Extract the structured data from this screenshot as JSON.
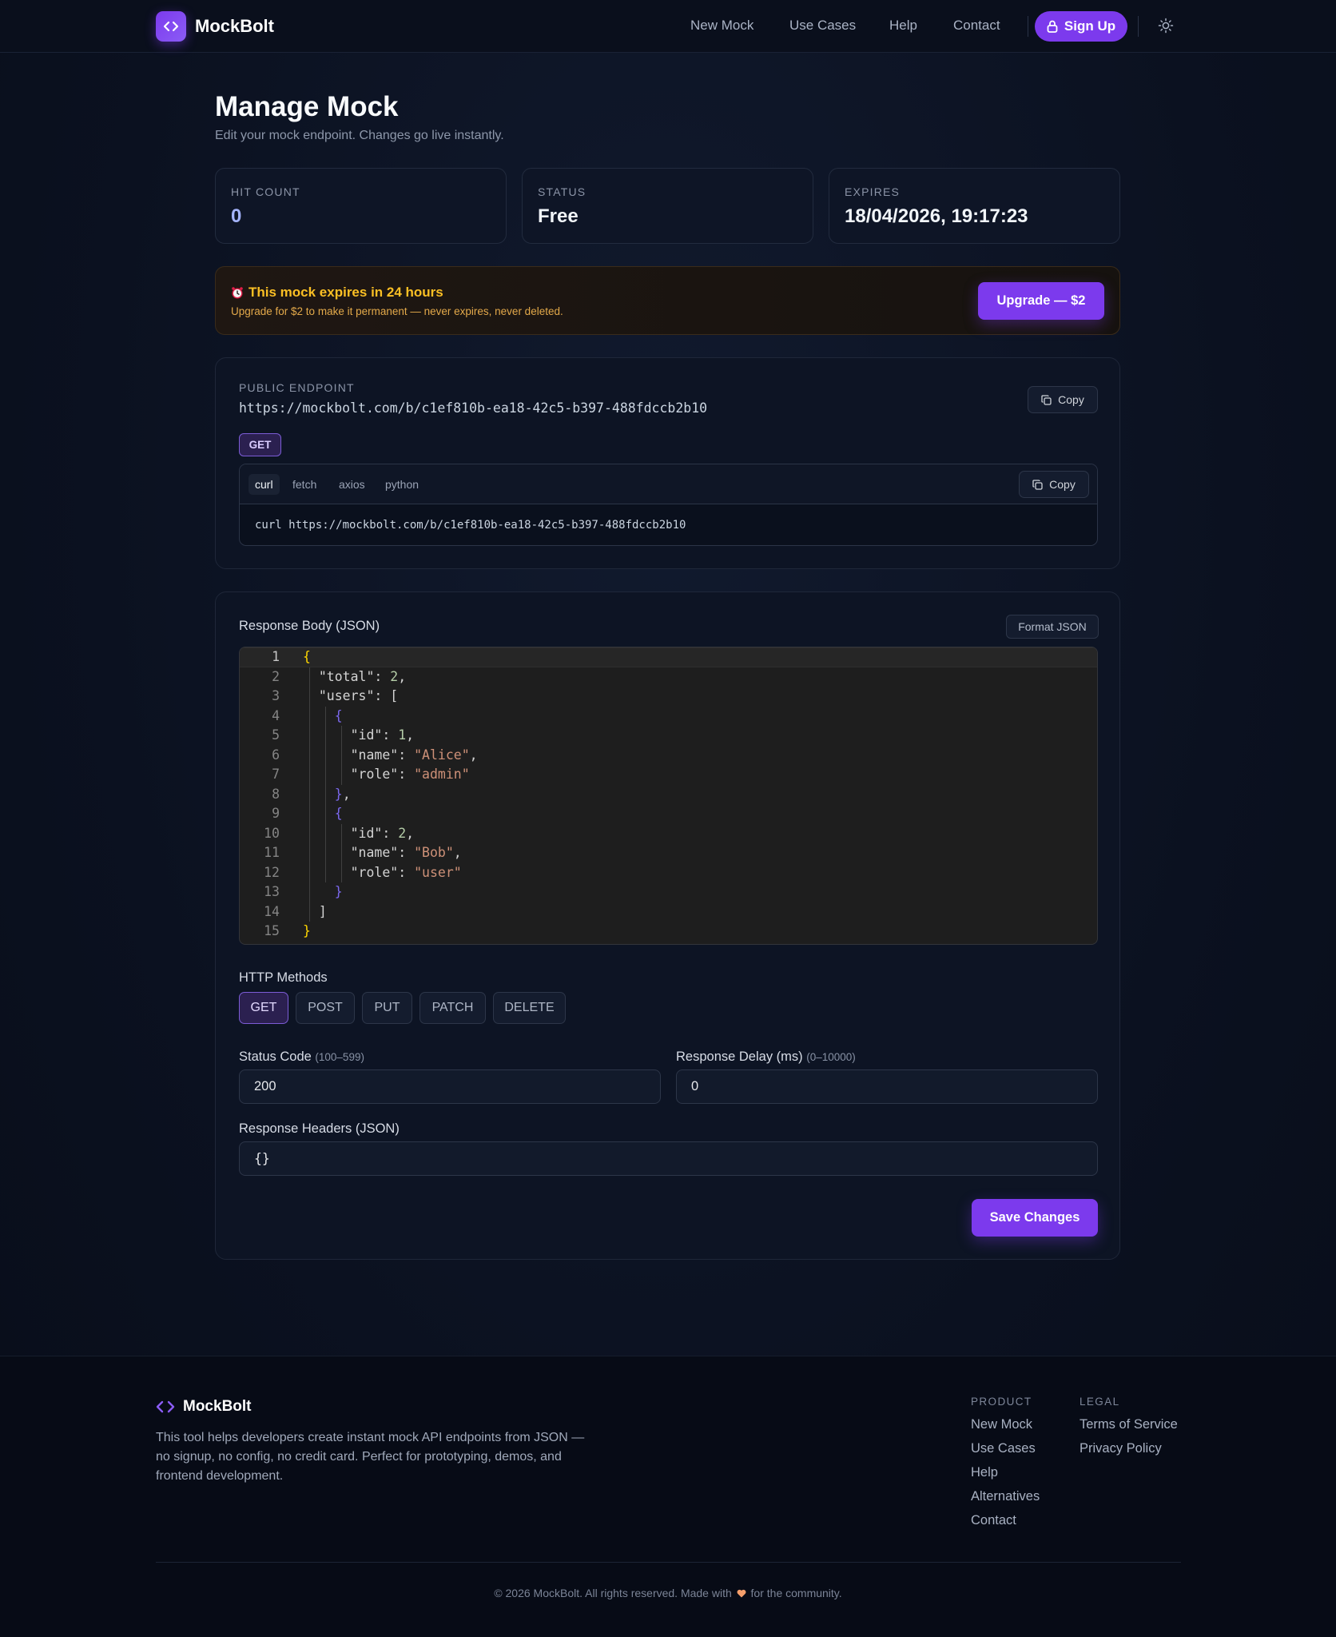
{
  "nav": {
    "brand": "MockBolt",
    "links": [
      "New Mock",
      "Use Cases",
      "Help",
      "Contact"
    ],
    "signup_label": "Sign Up"
  },
  "page": {
    "title": "Manage Mock",
    "subtitle": "Edit your mock endpoint. Changes go live instantly."
  },
  "stats": [
    {
      "label": "HIT COUNT",
      "value": "0",
      "color": "#a5b4fc"
    },
    {
      "label": "STATUS",
      "value": "Free",
      "color": "#f1f5f9"
    },
    {
      "label": "EXPIRES",
      "value": "18/04/2026, 19:17:23",
      "color": "#f1f5f9"
    }
  ],
  "banner": {
    "title": "This mock expires in 24 hours",
    "subtitle": "Upgrade for $2 to make it permanent — never expires, never deleted.",
    "button": "Upgrade — $2"
  },
  "endpoint": {
    "label": "PUBLIC ENDPOINT",
    "url": "https://mockbolt.com/b/c1ef810b-ea18-42c5-b397-488fdccb2b10",
    "copy_label": "Copy",
    "method": "GET",
    "tabs": [
      "curl",
      "fetch",
      "axios",
      "python"
    ],
    "active_tab": "curl",
    "snippet": "curl https://mockbolt.com/b/c1ef810b-ea18-42c5-b397-488fdccb2b10"
  },
  "editor": {
    "label": "Response Body (JSON)",
    "format_label": "Format JSON",
    "line_numbers": [
      "1",
      "2",
      "3",
      "4",
      "5",
      "6",
      "7",
      "8",
      "9",
      "10",
      "11",
      "12",
      "13",
      "14",
      "15"
    ]
  },
  "methods": {
    "label": "HTTP Methods",
    "items": [
      "GET",
      "POST",
      "PUT",
      "PATCH",
      "DELETE"
    ],
    "active": "GET"
  },
  "fields": {
    "status_code": {
      "label": "Status Code",
      "hint": "(100–599)",
      "value": "200"
    },
    "delay": {
      "label": "Response Delay (ms)",
      "hint": "(0–10000)",
      "value": "0"
    },
    "headers": {
      "label": "Response Headers (JSON)",
      "value": "{}"
    }
  },
  "save_label": "Save Changes",
  "footer": {
    "brand": "MockBolt",
    "description": "This tool helps developers create instant mock API endpoints from JSON — no signup, no config, no credit card. Perfect for prototyping, demos, and frontend development.",
    "product_heading": "PRODUCT",
    "product_links": [
      "New Mock",
      "Use Cases",
      "Help",
      "Alternatives",
      "Contact"
    ],
    "legal_heading": "LEGAL",
    "legal_links": [
      "Terms of Service",
      "Privacy Policy"
    ],
    "copyright_pre": "© 2026 MockBolt. All rights reserved. Made with",
    "copyright_post": "for the community."
  },
  "colors": {
    "accent": "#7c3aed",
    "warning": "#fbbf24"
  }
}
